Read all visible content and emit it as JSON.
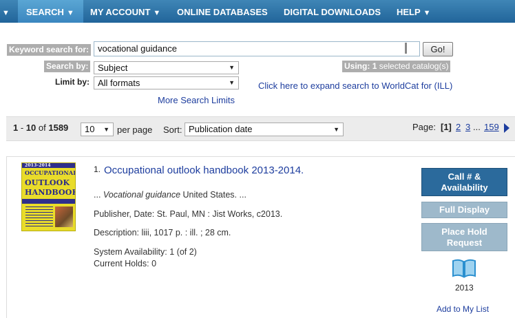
{
  "nav": {
    "partial_caret": "▼",
    "items": [
      {
        "label": "SEARCH",
        "caret": "▼"
      },
      {
        "label": "MY ACCOUNT",
        "caret": "▼"
      },
      {
        "label": "ONLINE DATABASES",
        "caret": ""
      },
      {
        "label": "DIGITAL DOWNLOADS",
        "caret": ""
      },
      {
        "label": "HELP",
        "caret": "▼"
      }
    ],
    "active_index": 0
  },
  "search": {
    "keyword_label": "Keyword search for:",
    "keyword_value": "vocational guidance",
    "go_label": "Go!",
    "search_by_label": "Search by:",
    "search_by_value": "Subject",
    "limit_by_label": "Limit by:",
    "limit_by_value": "All formats",
    "using_prefix": "Using:",
    "using_count": "1",
    "using_suffix": "selected catalog(s)",
    "worldcat_link": "Click here to expand search to WorldCat for (ILL)",
    "more_limits_link": "More Search Limits"
  },
  "results_bar": {
    "range_start": "1",
    "range_sep": " - ",
    "range_end": "10",
    "of_label": "of",
    "total": "1589",
    "per_page_value": "10",
    "per_page_label": "per page",
    "sort_label": "Sort:",
    "sort_value": "Publication date",
    "page_label": "Page:",
    "current_page": "[1]",
    "pages": [
      "2",
      "3"
    ],
    "ellipsis": "...",
    "last_page": "159"
  },
  "result": {
    "number": "1.",
    "title": "Occupational outlook handbook 2013-2014.",
    "snippet_prefix": "...",
    "snippet_italic": "Vocational guidance",
    "snippet_suffix": "United States. ...",
    "publisher_label": "Publisher, Date:",
    "publisher_value": "St. Paul, MN : Jist Works, c2013.",
    "description_label": "Description:",
    "description_value": "liii, 1017 p. : ill. ; 28 cm.",
    "availability_label": "System Availability:",
    "availability_value": "1 (of 2)",
    "holds_label": "Current Holds:",
    "holds_value": "0",
    "cover": {
      "edition": "2013-2014",
      "line1": "OCCUPATIONAL",
      "line2": "OUTLOOK",
      "line3": "HANDBOOK"
    },
    "actions": {
      "call_line1": "Call # &",
      "call_line2": "Availability",
      "full_display": "Full Display",
      "hold_line1": "Place Hold",
      "hold_line2": "Request"
    },
    "format_icon": "book-icon",
    "year": "2013",
    "add_to_list": "Add to My List"
  },
  "colors": {
    "nav_top": "#3f86b6",
    "nav_bottom": "#21649a",
    "link": "#1d3d9e",
    "primary_button": "#2b6a9c",
    "secondary_button": "#9eb9cb",
    "label_gray": "#adadad"
  }
}
